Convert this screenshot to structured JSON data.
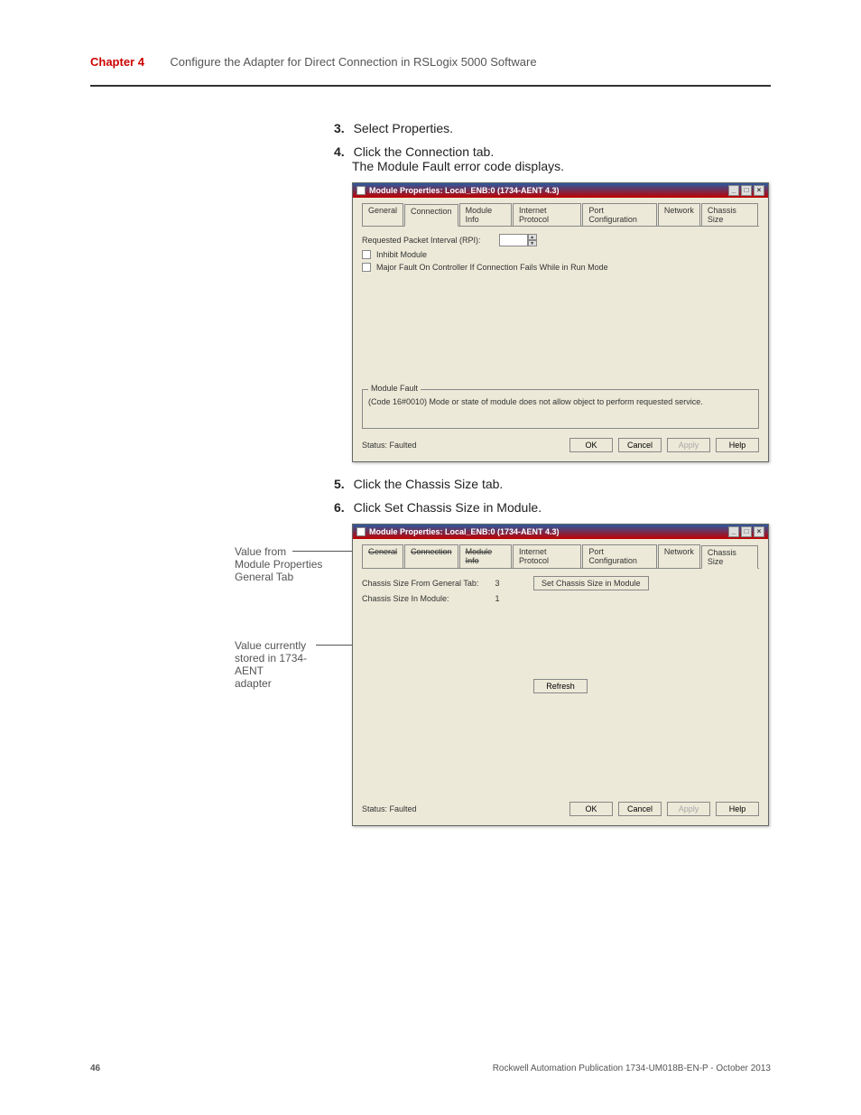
{
  "header": {
    "chapter": "Chapter 4",
    "title": "Configure the Adapter for Direct Connection in RSLogix 5000 Software"
  },
  "steps": {
    "s3_num": "3.",
    "s3": "Select Properties.",
    "s4_num": "4.",
    "s4": "Click the Connection tab.",
    "s4b": "The Module Fault error code displays.",
    "s5_num": "5.",
    "s5": "Click the Chassis Size tab.",
    "s6_num": "6.",
    "s6": "Click Set Chassis Size in Module."
  },
  "dlg1": {
    "title": "Module Properties: Local_ENB:0 (1734-AENT 4.3)",
    "tabs": {
      "general": "General",
      "connection": "Connection",
      "module_info": "Module Info",
      "internet": "Internet Protocol",
      "port": "Port Configuration",
      "network": "Network",
      "chassis": "Chassis Size"
    },
    "rpi_label": "Requested Packet Interval (RPI):",
    "inhibit": "Inhibit Module",
    "majorfault": "Major Fault On Controller If Connection Fails While in Run Mode",
    "fault_legend": "Module Fault",
    "fault_msg": "(Code 16#0010) Mode or state of module does not allow object to perform requested service.",
    "status_label": "Status:",
    "status_val": "Faulted",
    "btns": {
      "ok": "OK",
      "cancel": "Cancel",
      "apply": "Apply",
      "help": "Help"
    }
  },
  "dlg2": {
    "title": "Module Properties: Local_ENB:0 (1734-AENT 4.3)",
    "tabs": {
      "general": "General",
      "connection": "Connection",
      "module_info": "Module Info",
      "internet": "Internet Protocol",
      "port": "Port Configuration",
      "network": "Network",
      "chassis": "Chassis Size"
    },
    "row1_lbl": "Chassis Size From General Tab:",
    "row1_val": "3",
    "row2_lbl": "Chassis Size In Module:",
    "row2_val": "1",
    "set_btn": "Set Chassis Size in Module",
    "refresh": "Refresh",
    "status_label": "Status:",
    "status_val": "Faulted",
    "btns": {
      "ok": "OK",
      "cancel": "Cancel",
      "apply": "Apply",
      "help": "Help"
    }
  },
  "callouts": {
    "c1a": "Value from",
    "c1b": "Module Properties",
    "c1c": "General Tab",
    "c2a": "Value currently",
    "c2b": "stored in 1734-",
    "c2c": "AENT",
    "c2d": "adapter"
  },
  "footer": {
    "page": "46",
    "pub": "Rockwell Automation Publication 1734-UM018B-EN-P - October 2013"
  }
}
